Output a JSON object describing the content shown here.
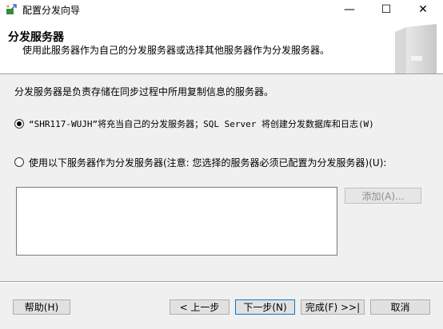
{
  "window": {
    "title": "配置分发向导",
    "min_glyph": "—",
    "max_glyph": "☐",
    "close_glyph": "✕"
  },
  "header": {
    "title": "分发服务器",
    "subtitle": "使用此服务器作为自己的分发服务器或选择其他服务器作为分发服务器。"
  },
  "body": {
    "description": "分发服务器是负责存储在同步过程中所用复制信息的服务器。",
    "option1_label": "“SHR117-WUJH”将充当自己的分发服务器；SQL Server 将创建分发数据库和日志(W)",
    "option1_selected": true,
    "option2_label": "使用以下服务器作为分发服务器(注意: 您选择的服务器必须已配置为分发服务器)(U):",
    "option2_selected": false,
    "add_button_label": "添加(A)..."
  },
  "footer": {
    "help_label": "帮助(H)",
    "back_label": "< 上一步",
    "next_label": "下一步(N)",
    "finish_label": "完成(F) >>|",
    "cancel_label": "取消"
  }
}
